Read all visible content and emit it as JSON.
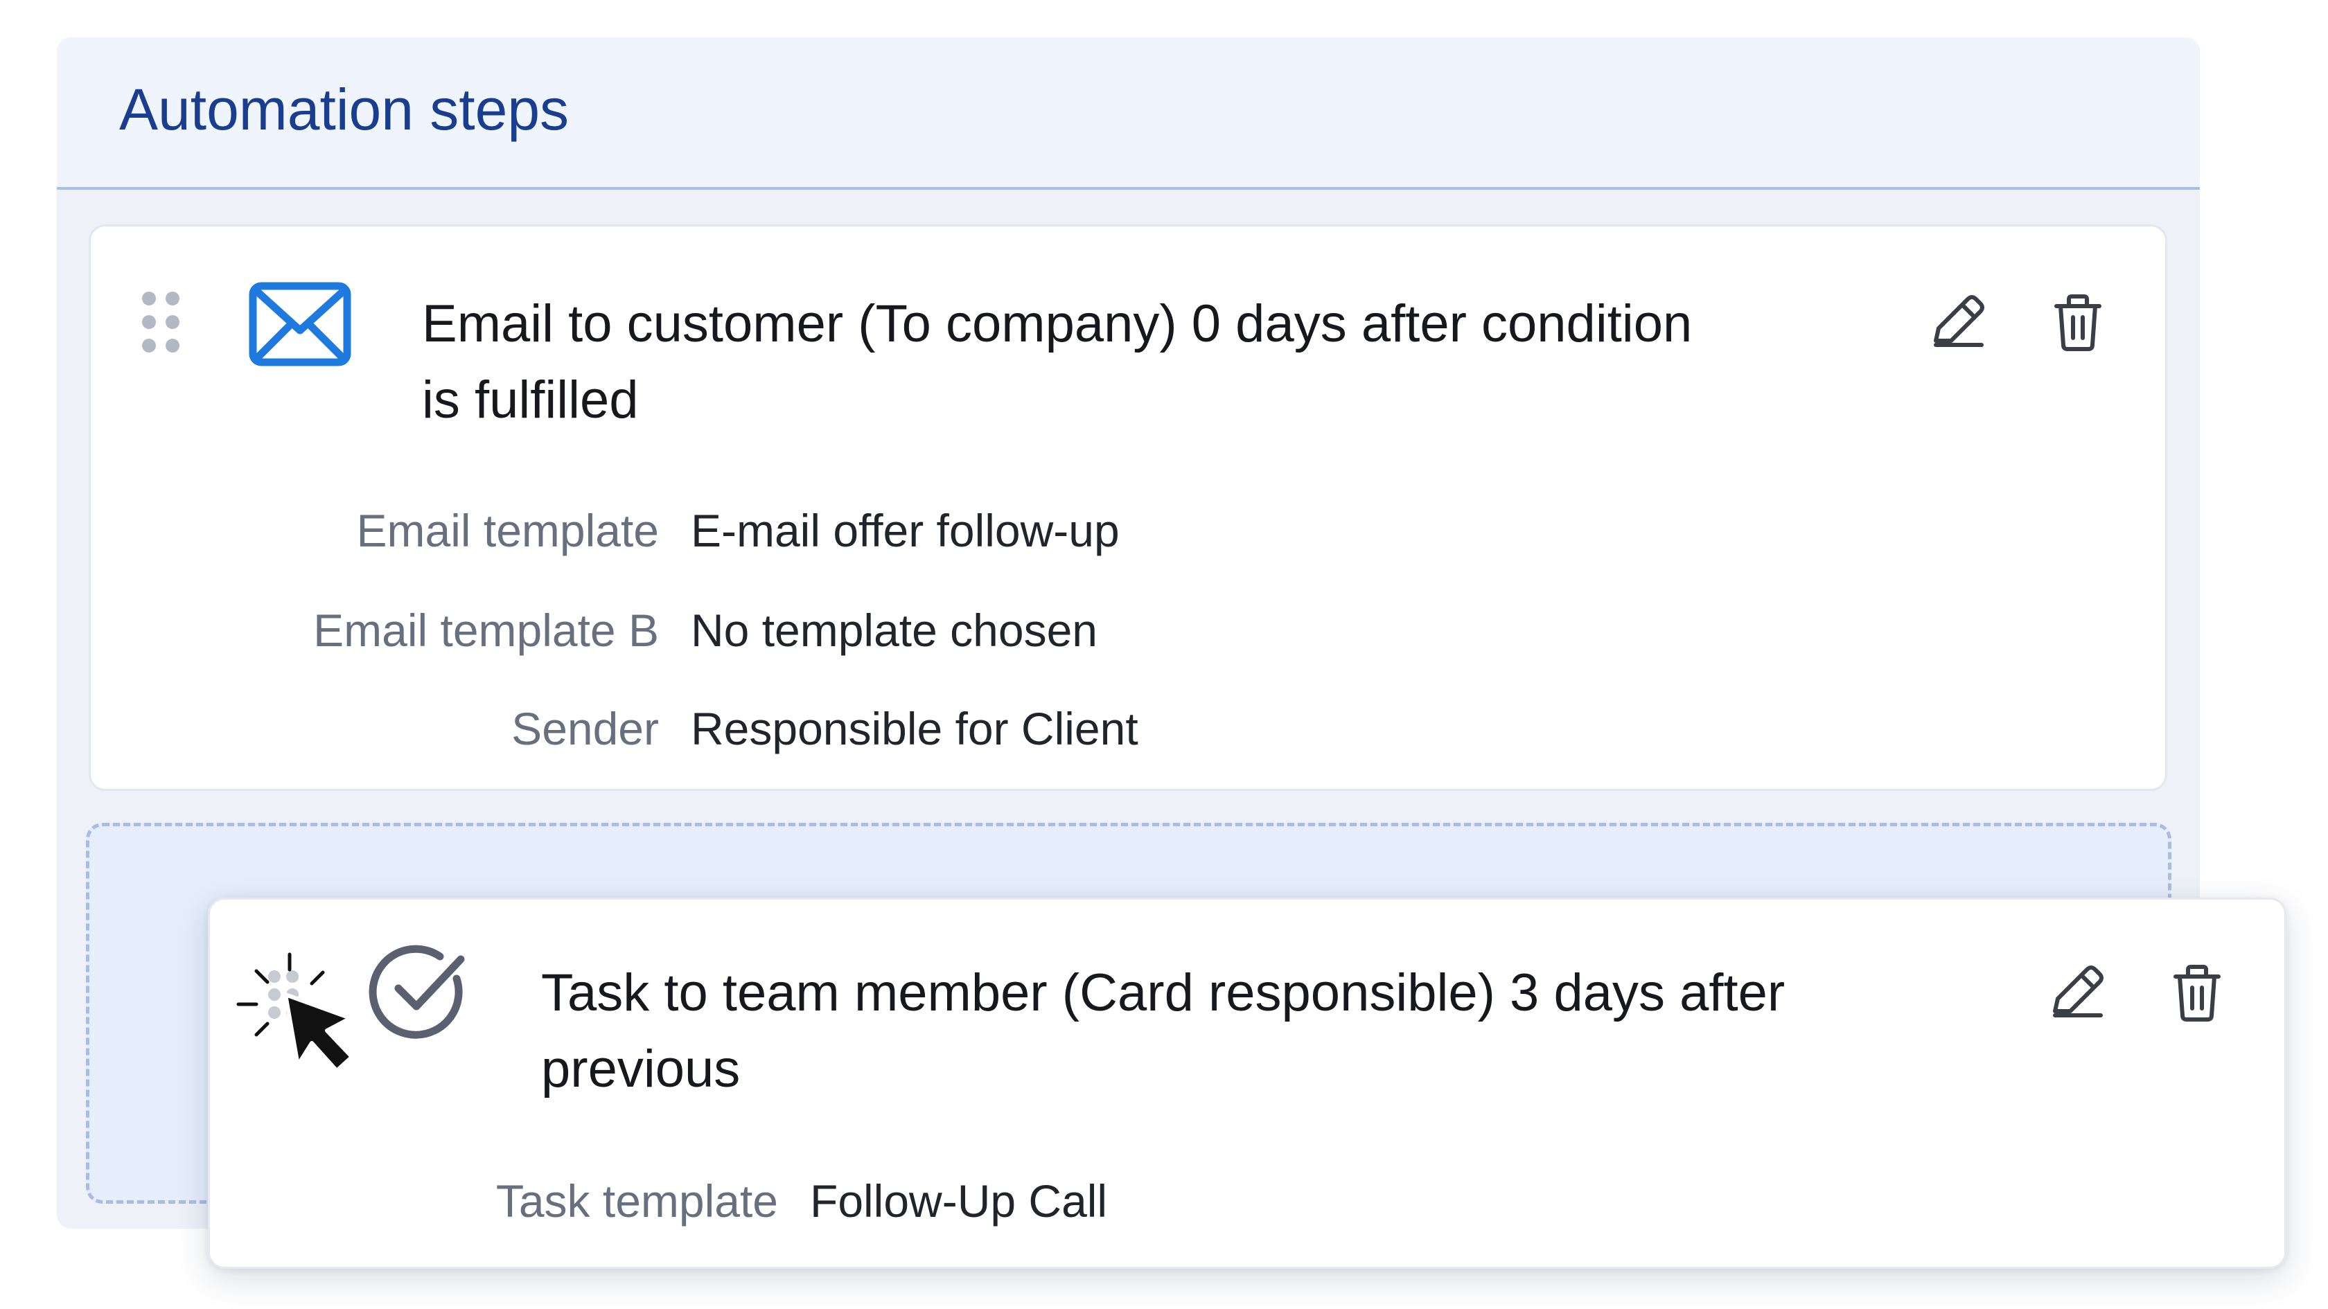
{
  "panel": {
    "title": "Automation steps"
  },
  "steps": [
    {
      "icon": "envelope-icon",
      "title_line1": "Email to customer (To company) 0 days after condition",
      "title_line2": "is fulfilled",
      "fields": [
        {
          "label": "Email template",
          "value": "E-mail offer follow-up"
        },
        {
          "label": "Email template B",
          "value": "No template chosen"
        },
        {
          "label": "Sender",
          "value": "Responsible for Client"
        }
      ]
    },
    {
      "icon": "check-circle-icon",
      "title_line1": "Task to team member (Card responsible) 3 days after",
      "title_line2": "previous",
      "fields": [
        {
          "label": "Task template",
          "value": "Follow-Up Call"
        }
      ]
    }
  ],
  "colors": {
    "accent": "#1a3e8f",
    "icon_blue": "#1f7ae0",
    "dropzone_fill": "#e6edfb",
    "dropzone_border": "#a8bde6"
  }
}
